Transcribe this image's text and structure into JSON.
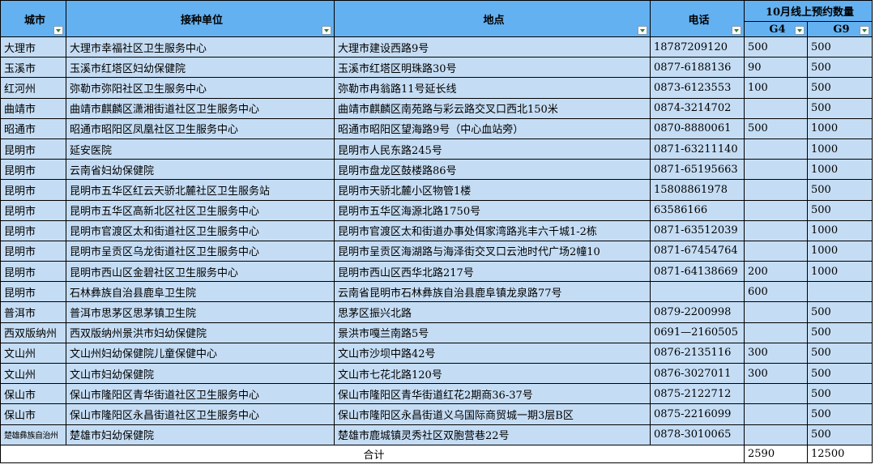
{
  "header": {
    "city": "城市",
    "unit": "接种单位",
    "address": "地点",
    "phone": "电话",
    "booking_group": "10月线上预约数量",
    "g4": "G4",
    "g9": "G9"
  },
  "rows": [
    {
      "city": "大理市",
      "unit": "大理市幸福社区卫生服务中心",
      "address": "大理市建设西路9号",
      "phone": "18787209120",
      "g4": "500",
      "g9": "500"
    },
    {
      "city": "玉溪市",
      "unit": "玉溪市红塔区妇幼保健院",
      "address": "玉溪市红塔区明珠路30号",
      "phone": "0877-6188136",
      "g4": "90",
      "g9": "500"
    },
    {
      "city": "红河州",
      "unit": "弥勒市弥阳社区卫生服务中心",
      "address": "弥勒市冉翁路11号延长线",
      "phone": "0873-6123553",
      "g4": "100",
      "g9": "500"
    },
    {
      "city": "曲靖市",
      "unit": "曲靖市麒麟区潇湘街道社区卫生服务中心",
      "address": "曲靖市麒麟区南苑路与彩云路交叉口西北150米",
      "phone": "0874-3214702",
      "g4": "",
      "g9": "500"
    },
    {
      "city": "昭通市",
      "unit": "昭通市昭阳区凤凰社区卫生服务中心",
      "address": "昭通市昭阳区望海路9号（中心血站旁）",
      "phone": "0870-8880061",
      "g4": "500",
      "g9": "1000"
    },
    {
      "city": "昆明市",
      "unit": "延安医院",
      "address": "昆明市人民东路245号",
      "phone": "0871-63211140",
      "g4": "",
      "g9": "1000"
    },
    {
      "city": "昆明市",
      "unit": "云南省妇幼保健院",
      "address": "昆明市盘龙区鼓楼路86号",
      "phone": "0871-65195663",
      "g4": "",
      "g9": "1000"
    },
    {
      "city": "昆明市",
      "unit": "昆明市五华区红云天骄北麓社区卫生服务站",
      "address": "昆明市天骄北麓小区物管1楼",
      "phone": "15808861978",
      "g4": "",
      "g9": "500"
    },
    {
      "city": "昆明市",
      "unit": "昆明市五华区高新北区社区卫生服务中心",
      "address": "昆明市五华区海源北路1750号",
      "phone": "63586166",
      "g4": "",
      "g9": "500"
    },
    {
      "city": "昆明市",
      "unit": "昆明市官渡区太和街道社区卫生服务中心",
      "address": "昆明市官渡区太和街道办事处佴家湾路兆丰六千城1-2栋",
      "phone": "0871-63512039",
      "g4": "",
      "g9": "1000"
    },
    {
      "city": "昆明市",
      "unit": "昆明市呈贡区乌龙街道社区卫生服务中心",
      "address": "昆明市呈贡区海湖路与海泽街交叉口云池时代广场2幢10",
      "phone": "0871-67454764",
      "g4": "",
      "g9": "1000"
    },
    {
      "city": "昆明市",
      "unit": "昆明市西山区金碧社区卫生服务中心",
      "address": "昆明市西山区西华北路217号",
      "phone": "0871-64138669",
      "g4": "200",
      "g9": "1000"
    },
    {
      "city": "昆明市",
      "unit": "石林彝族自治县鹿阜卫生院",
      "address": "云南省昆明市石林彝族自治县鹿阜镇龙泉路77号",
      "phone": "",
      "g4": "600",
      "g9": ""
    },
    {
      "city": "普洱市",
      "unit": "普洱市思茅区思茅镇卫生院",
      "address": "思茅区振兴北路",
      "phone": "0879-2200998",
      "g4": "",
      "g9": "500"
    },
    {
      "city": "西双版纳州",
      "unit": "西双版纳州景洪市妇幼保健院",
      "address": "景洪市嘎兰南路5号",
      "phone": "0691—2160505",
      "g4": "",
      "g9": "500"
    },
    {
      "city": "文山州",
      "unit": "文山州妇幼保健院儿童保健中心",
      "address": "文山市沙坝中路42号",
      "phone": "0876-2135116",
      "g4": "300",
      "g9": "500"
    },
    {
      "city": "文山州",
      "unit": "文山市妇幼保健院",
      "address": "文山市七花北路120号",
      "phone": "0876-3027011",
      "g4": "300",
      "g9": "500"
    },
    {
      "city": "保山市",
      "unit": "保山市隆阳区青华街道社区卫生服务中心",
      "address": "保山市隆阳区青华街道红花2期商36-37号",
      "phone": "0875-2122712",
      "g4": "",
      "g9": "500"
    },
    {
      "city": "保山市",
      "unit": "保山市隆阳区永昌街道社区卫生服务中心",
      "address": "保山市隆阳区永昌街道义乌国际商贸城一期3层B区",
      "phone": "0875-2216099",
      "g4": "",
      "g9": "500"
    },
    {
      "city": "楚雄彝族自治州",
      "unit": "楚雄市妇幼保健院",
      "address": "楚雄市鹿城镇灵秀社区双胞营巷22号",
      "phone": "0878-3010065",
      "g4": "",
      "g9": "500"
    }
  ],
  "footer": {
    "total_label": "合计",
    "g4_total": "2590",
    "g9_total": "12500"
  },
  "icons": {
    "filter": "filter-dropdown-icon"
  },
  "colors": {
    "header_bg": "#63b1f1",
    "row_bg": "#c5ddf4"
  }
}
